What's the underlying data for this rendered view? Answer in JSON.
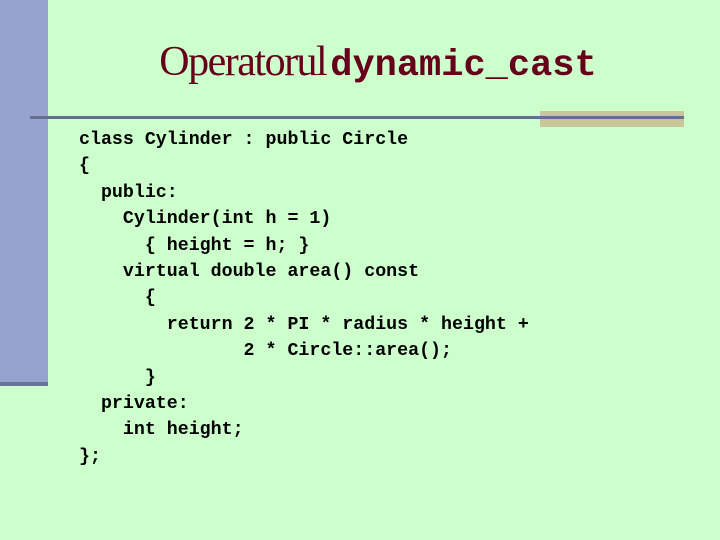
{
  "slide": {
    "title_text": "Operatorul",
    "title_code": "dynamic_cast",
    "code_lines": [
      "class Cylinder : public Circle",
      "{",
      "  public:",
      "    Cylinder(int h = 1)",
      "      { height = h; }",
      "    virtual double area() const",
      "      {",
      "        return 2 * PI * radius * height +",
      "               2 * Circle::area();",
      "      }",
      "  private:",
      "    int height;",
      "};"
    ]
  },
  "colors": {
    "background": "#ccffcc",
    "sidebar": "#96a3cf",
    "title": "#66001a",
    "divider": "#656e8e",
    "accent_bar": "#c9c79a"
  }
}
